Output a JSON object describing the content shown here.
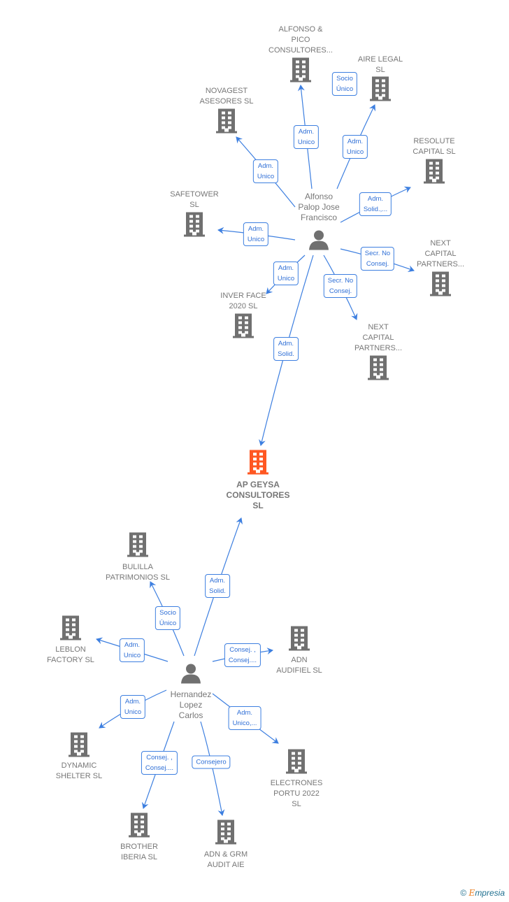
{
  "colors": {
    "edge": "#3d7fe0",
    "company": "#707070",
    "main_company": "#ff5722",
    "person": "#707070"
  },
  "persons": [
    {
      "name": "Alfonso\nPalop Jose\nFrancisco",
      "icon": "person-icon"
    },
    {
      "name": "Hernandez\nLopez\nCarlos",
      "icon": "person-icon"
    }
  ],
  "companies": [
    {
      "name": "ALFONSO &\nPICO\nCONSULTORES...",
      "icon": "building-icon"
    },
    {
      "name": "AIRE LEGAL\nSL",
      "icon": "building-icon"
    },
    {
      "name": "NOVAGEST\nASESORES  SL",
      "icon": "building-icon"
    },
    {
      "name": "RESOLUTE\nCAPITAL  SL",
      "icon": "building-icon"
    },
    {
      "name": "SAFETOWER\nSL",
      "icon": "building-icon"
    },
    {
      "name": "NEXT\nCAPITAL\nPARTNERS...",
      "icon": "building-icon"
    },
    {
      "name": "INVER FACE\n2020  SL",
      "icon": "building-icon"
    },
    {
      "name": "NEXT\nCAPITAL\nPARTNERS...",
      "icon": "building-icon"
    },
    {
      "name": "AP GEYSA\nCONSULTORES\nSL",
      "icon": "building-icon",
      "main": true
    },
    {
      "name": "BULILLA\nPATRIMONIOS SL",
      "icon": "building-icon"
    },
    {
      "name": "LEBLON\nFACTORY  SL",
      "icon": "building-icon"
    },
    {
      "name": "ADN\nAUDIFIEL  SL",
      "icon": "building-icon"
    },
    {
      "name": "DYNAMIC\nSHELTER  SL",
      "icon": "building-icon"
    },
    {
      "name": "ELECTRONES\nPORTU 2022\nSL",
      "icon": "building-icon"
    },
    {
      "name": "BROTHER\nIBERIA SL",
      "icon": "building-icon"
    },
    {
      "name": "ADN & GRM\nAUDIT  AIE",
      "icon": "building-icon"
    }
  ],
  "edges": [
    {
      "from": 0,
      "to": 0,
      "label": "Adm.\nUnico"
    },
    {
      "from": 0,
      "to": 1,
      "label": "Adm.\nUnico",
      "extra_label": "Socio\nÚnico"
    },
    {
      "from": 0,
      "to": 2,
      "label": "Adm.\nUnico"
    },
    {
      "from": 0,
      "to": 3,
      "label": "Adm.\nSolid.,..."
    },
    {
      "from": 0,
      "to": 4,
      "label": "Adm.\nUnico"
    },
    {
      "from": 0,
      "to": 5,
      "label": "Secr.  No\nConsej."
    },
    {
      "from": 0,
      "to": 6,
      "label": "Adm.\nUnico"
    },
    {
      "from": 0,
      "to": 7,
      "label": "Secr.  No\nConsej."
    },
    {
      "from": 0,
      "to": 8,
      "label": "Adm.\nSolid."
    },
    {
      "from": 1,
      "to": 8,
      "label": "Adm.\nSolid."
    },
    {
      "from": 1,
      "to": 9,
      "label": "Socio\nÚnico"
    },
    {
      "from": 1,
      "to": 10,
      "label": "Adm.\nUnico"
    },
    {
      "from": 1,
      "to": 11,
      "label": "Consej. ,\nConsej...."
    },
    {
      "from": 1,
      "to": 12,
      "label": "Adm.\nUnico"
    },
    {
      "from": 1,
      "to": 13,
      "label": "Adm.\nUnico,..."
    },
    {
      "from": 1,
      "to": 14,
      "label": "Consej. ,\nConsej...."
    },
    {
      "from": 1,
      "to": 15,
      "label": "Consejero"
    }
  ],
  "footer": {
    "copyright": "©",
    "brand_initial": "E",
    "brand_rest": "mpresia"
  }
}
